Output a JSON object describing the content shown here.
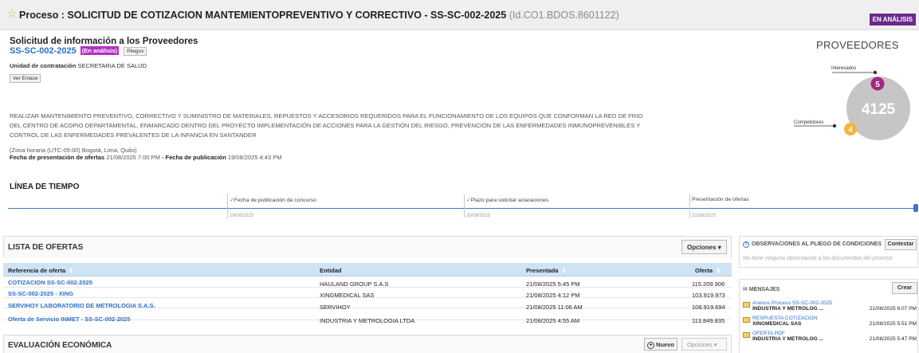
{
  "header": {
    "title": "Proceso : SOLICITUD DE COTIZACION MANTEMIENTOPREVENTIVO Y CORRECTIVO  - SS-SC-002-2025",
    "process_id": "(Id.CO1.BDOS.8601122)",
    "status": "EN ANÁLISIS"
  },
  "info": {
    "title": "Solicitud de información a los Proveedores",
    "reference": "SS-SC-002-2025",
    "status_tag": "(En análisis)",
    "pliegos_label": "Pliegos",
    "unit_label": "Unidad de contratación",
    "unit_value": "SECRETARIA DE SALUD",
    "ver_enlace_label": "Ver Enlace",
    "description": "REALIZAR MANTENIMIENTO PREVENTIVO, CORRECTIVO Y SUMINISTRO DE MATERIALES, REPUESTOS Y ACCESORIOS REQUERIDOS PARA EL FUNCIONAMIENTO DE LOS EQUIPOS QUE CONFORMAN LA RED DE FRIO DEL CENTRO DE ACOPIO DEPARTAMENTAL, ENMARCADO DENTRO DEL PROYECTO IMPLEMENTACIÓN DE ACCIONES PARA LA GESTIÓN DEL RIESGO, PREVENCIÓN DE LAS ENFERMEDADES INMUNOPREVENIBLES Y CONTROL DE LAS ENFERMEDADES PREVALENTES DE LA INFANCIA EN SANTANDER",
    "timezone": "(Zona horaria (UTC-05:00) Bogotá, Lima, Quito)",
    "offers_date_label": "Fecha de presentación de ofertas",
    "offers_date": "21/08/2025 7:00 PM",
    "separator": " - ",
    "pub_date_label": "Fecha de publicación",
    "pub_date": "19/08/2025 4:43 PM"
  },
  "proveedores": {
    "title": "PROVEEDORES",
    "interesados_label": "Interesados",
    "interesados_count": "5",
    "competidores_label": "Competidores",
    "competidores_count": "4",
    "total": "4125",
    "colors": {
      "interesados": "#a5287f",
      "competidores": "#f2b441",
      "total": "#c6c6c6"
    }
  },
  "timeline": {
    "title": "LÍNEA DE TIEMPO",
    "check_icon": "✓",
    "events": [
      {
        "label": "Fecha de publicación de concurso",
        "date": "19/08/2025"
      },
      {
        "label": "Plazo para solicitar aclaraciones",
        "date": "20/08/2025"
      },
      {
        "label": "Presentación de ofertas",
        "date": "21/08/2025"
      }
    ]
  },
  "offers": {
    "title": "LISTA DE OFERTAS",
    "options_label": "Opciones",
    "columns": [
      "Referencia de oferta",
      "Entidad",
      "Presentada",
      "Oferta"
    ],
    "rows": [
      {
        "ref": "COTIZACION SS-SC-002-2025",
        "entity": "HAULAND GROUP S.A.S",
        "date": "21/08/2025 5:45 PM",
        "amount": "115.209.906"
      },
      {
        "ref": "SS-SC-002-2025 - XING",
        "entity": "XINGMEDICAL SAS",
        "date": "21/08/2025 4:12 PM",
        "amount": "103.919.973"
      },
      {
        "ref": "SERVIHOY LABORATORIO DE METROLOGIA S.A.S.",
        "entity": "SERVIHOY",
        "date": "21/08/2025 11:06 AM",
        "amount": "108.919.694"
      },
      {
        "ref": "Oferta de Servicio INMET - SS-SC-002-2025",
        "entity": "INDUSTRIA Y METROLOGIA LTDA",
        "date": "21/08/2025 4:55 AM",
        "amount": "113.849.835"
      }
    ]
  },
  "evaluation": {
    "title": "EVALUACIÓN ECONÓMICA",
    "new_label": "Nuevo",
    "options_label": "Opciones"
  },
  "observations": {
    "title": "OBSERVACIONES AL PLIEGO DE CONDICIONES",
    "action": "Contestar",
    "empty": "No tiene ninguna observación a los documentos del proceso"
  },
  "messages": {
    "title": "MENSAJES",
    "action": "Crear",
    "items": [
      {
        "subject": "Anexos Proceso SS-SC-002-2025",
        "from": "INDUSTRIA Y METROLOG ...",
        "date": "21/08/2025 6:07 PM"
      },
      {
        "subject": "RESPUESTA COTIZACION",
        "from": "XINGMEDICAL SAS",
        "date": "21/08/2025 5:51 PM"
      },
      {
        "subject": "OFERTA PDF",
        "from": "INDUSTRIA Y METROLOG ...",
        "date": "21/08/2025 5:47 PM"
      }
    ]
  }
}
